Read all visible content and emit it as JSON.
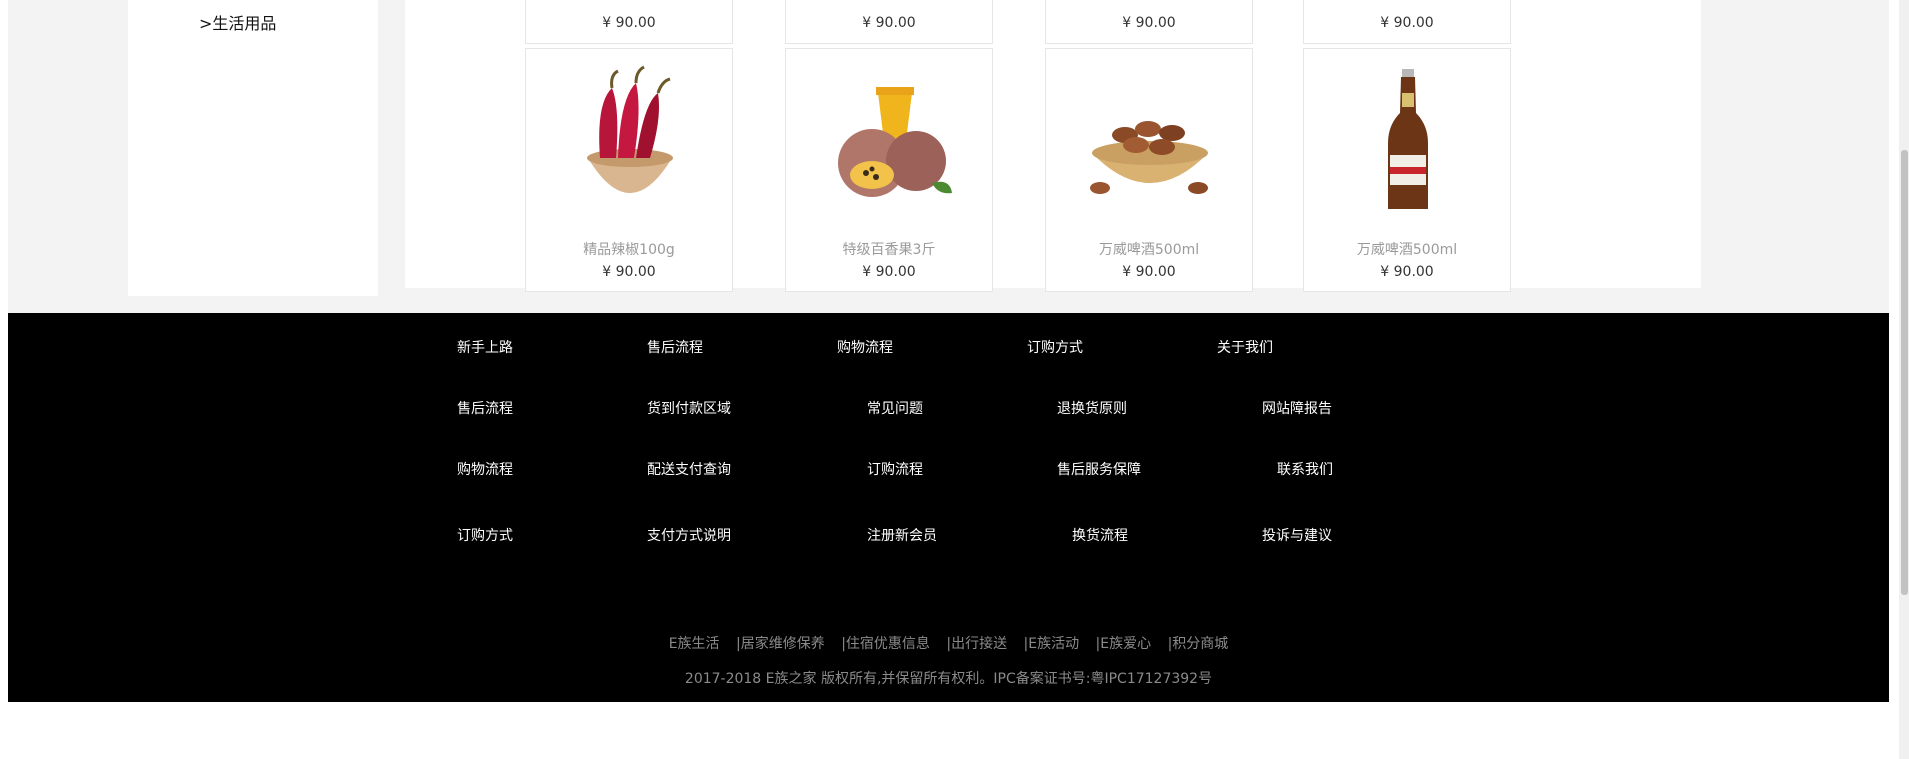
{
  "sidebar": {
    "item_label": ">生活用品"
  },
  "products": {
    "top_row_prices": [
      "¥ 90.00",
      "¥ 90.00",
      "¥ 90.00",
      "¥ 90.00"
    ],
    "items": [
      {
        "name": "精品辣椒100g",
        "price": "¥ 90.00"
      },
      {
        "name": "特级百香果3斤",
        "price": "¥ 90.00"
      },
      {
        "name": "万威啤酒500ml",
        "price": "¥ 90.00"
      },
      {
        "name": "万威啤酒500ml",
        "price": "¥ 90.00"
      }
    ]
  },
  "footer": {
    "columns": [
      [
        "新手上路",
        "售后流程",
        "购物流程",
        "订购方式"
      ],
      [
        "售后流程",
        "货到付款区域",
        "配送支付查询",
        "支付方式说明"
      ],
      [
        "购物流程",
        "常见问题",
        "订购流程",
        "注册新会员"
      ],
      [
        "订购方式",
        "退换货原则",
        "售后服务保障",
        "换货流程"
      ],
      [
        "关于我们",
        "网站障报告",
        "联系我们",
        "投诉与建议"
      ]
    ],
    "bottom_links": [
      "E族生活",
      "|居家维修保养",
      "|住宿优惠信息",
      "|出行接送",
      "|E族活动",
      "|E族爱心",
      "|积分商城"
    ],
    "copyright": "2017-2018 E族之家 版权所有,并保留所有权利。IPC备案证书号:粤IPC17127392号"
  },
  "colors": {
    "footer_bg": "#000000",
    "footer_text": "#ffffff",
    "muted_text": "#8a8a8a",
    "page_bg": "#f3f3f3"
  }
}
